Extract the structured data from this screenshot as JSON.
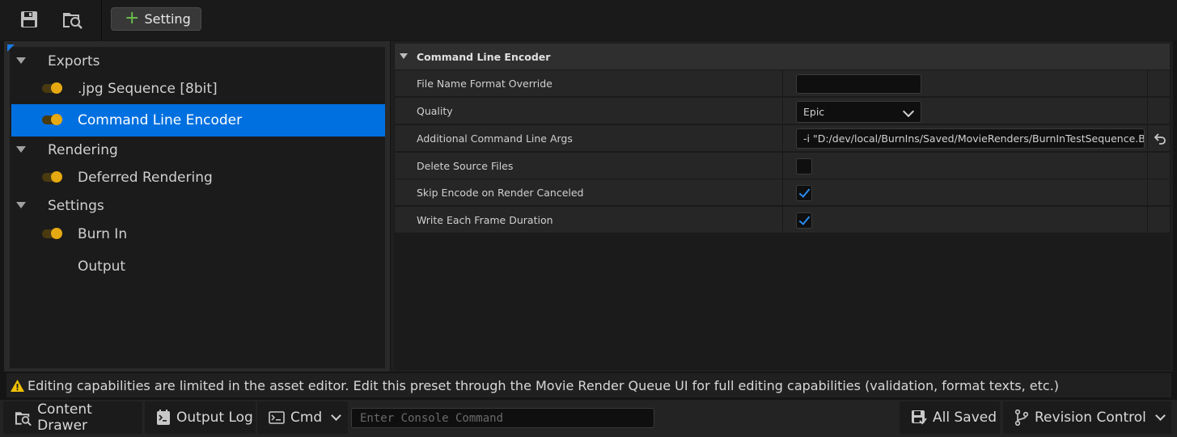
{
  "toolbar": {
    "save_icon": "save-icon",
    "browse_icon": "browse-folder-icon",
    "add_setting_label": "Setting"
  },
  "tree": {
    "categories": [
      {
        "label": "Exports",
        "items": [
          {
            "label": ".jpg Sequence [8bit]",
            "enabled": true
          },
          {
            "label": "Command Line Encoder",
            "enabled": true,
            "selected": true
          }
        ]
      },
      {
        "label": "Rendering",
        "items": [
          {
            "label": "Deferred Rendering",
            "enabled": true
          }
        ]
      },
      {
        "label": "Settings",
        "items": [
          {
            "label": "Burn In",
            "enabled": true
          },
          {
            "label": "Output",
            "enabled": null
          }
        ]
      }
    ]
  },
  "details": {
    "section_title": "Command Line Encoder",
    "rows": [
      {
        "label": "File Name Format Override",
        "value": ""
      },
      {
        "label": "Quality",
        "value": "Epic"
      },
      {
        "label": "Additional Command Line Args",
        "value": "-i \"D:/dev/local/BurnIns/Saved/MovieRenders/BurnInTestSequence.B"
      },
      {
        "label": "Delete Source Files",
        "checked": false
      },
      {
        "label": "Skip Encode on Render Canceled",
        "checked": true
      },
      {
        "label": "Write Each Frame Duration",
        "checked": true
      }
    ]
  },
  "warning": {
    "text": "Editing capabilities are limited in the asset editor. Edit this preset through the Movie Render Queue UI for full editing capabilities (validation, format texts, etc.)"
  },
  "statusbar": {
    "content_drawer": "Content Drawer",
    "output_log": "Output Log",
    "cmd": "Cmd",
    "console_placeholder": "Enter Console Command",
    "all_saved": "All Saved",
    "revision_control": "Revision Control"
  },
  "colors": {
    "selection": "#0070e0",
    "toggle_on": "#e6a912",
    "checkmark": "#2a8cf0",
    "add_plus": "#6cc24a",
    "warning": "#f2c200"
  }
}
